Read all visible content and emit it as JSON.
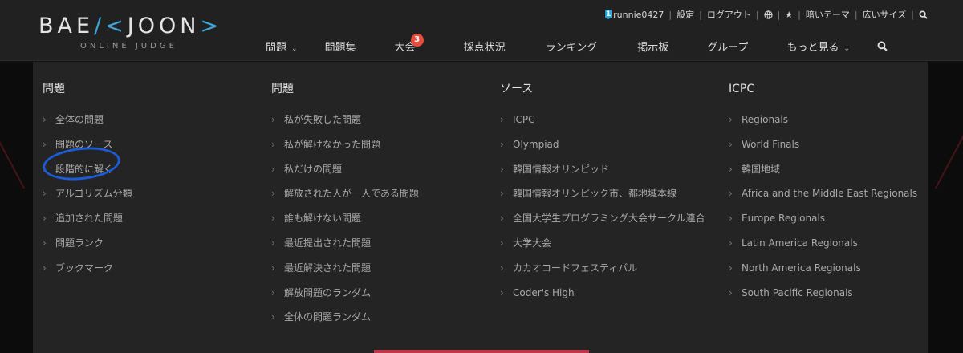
{
  "logo": {
    "main_pre": "BAE",
    "main_mark": "/<",
    "main_post": "JOON",
    "main_end": ">",
    "sub": "ONLINE JUDGE"
  },
  "topbar": {
    "tier": "1",
    "username": "runnie0427",
    "settings": "設定",
    "logout": "ログアウト",
    "dark_theme": "暗いテーマ",
    "wide_size": "広いサイズ"
  },
  "nav": {
    "problems": "問題",
    "workbook": "問題集",
    "contest": "大会",
    "contest_badge": "3",
    "status": "採点状況",
    "ranking": "ランキング",
    "board": "掲示板",
    "group": "グループ",
    "more": "もっと見る"
  },
  "columns": [
    {
      "title": "問題",
      "items": [
        "全体の問題",
        "問題のソース",
        "段階的に解く",
        "アルゴリズム分類",
        "追加された問題",
        "問題ランク",
        "ブックマーク"
      ]
    },
    {
      "title": "問題",
      "items": [
        "私が失敗した問題",
        "私が解けなかった問題",
        "私だけの問題",
        "解放された人が一人である問題",
        "誰も解けない問題",
        "最近提出された問題",
        "最近解決された問題",
        "解放問題のランダム",
        "全体の問題ランダム"
      ]
    },
    {
      "title": "ソース",
      "items": [
        "ICPC",
        "Olympiad",
        "韓国情報オリンピッド",
        "韓国情報オリンピック市、都地域本線",
        "全国大学生プログラミング大会サークル連合",
        "大学大会",
        "カカオコードフェスティバル",
        "Coder's High"
      ]
    },
    {
      "title": "ICPC",
      "items": [
        "Regionals",
        "World Finals",
        "韓国地域",
        "Africa and the Middle East Regionals",
        "Europe Regionals",
        "Latin America Regionals",
        "North America Regionals",
        "South Pacific Regionals"
      ]
    }
  ],
  "colors": {
    "accent": "#3ea6d8",
    "badge": "#e74c3c",
    "annotation": "#1c5bd6"
  }
}
